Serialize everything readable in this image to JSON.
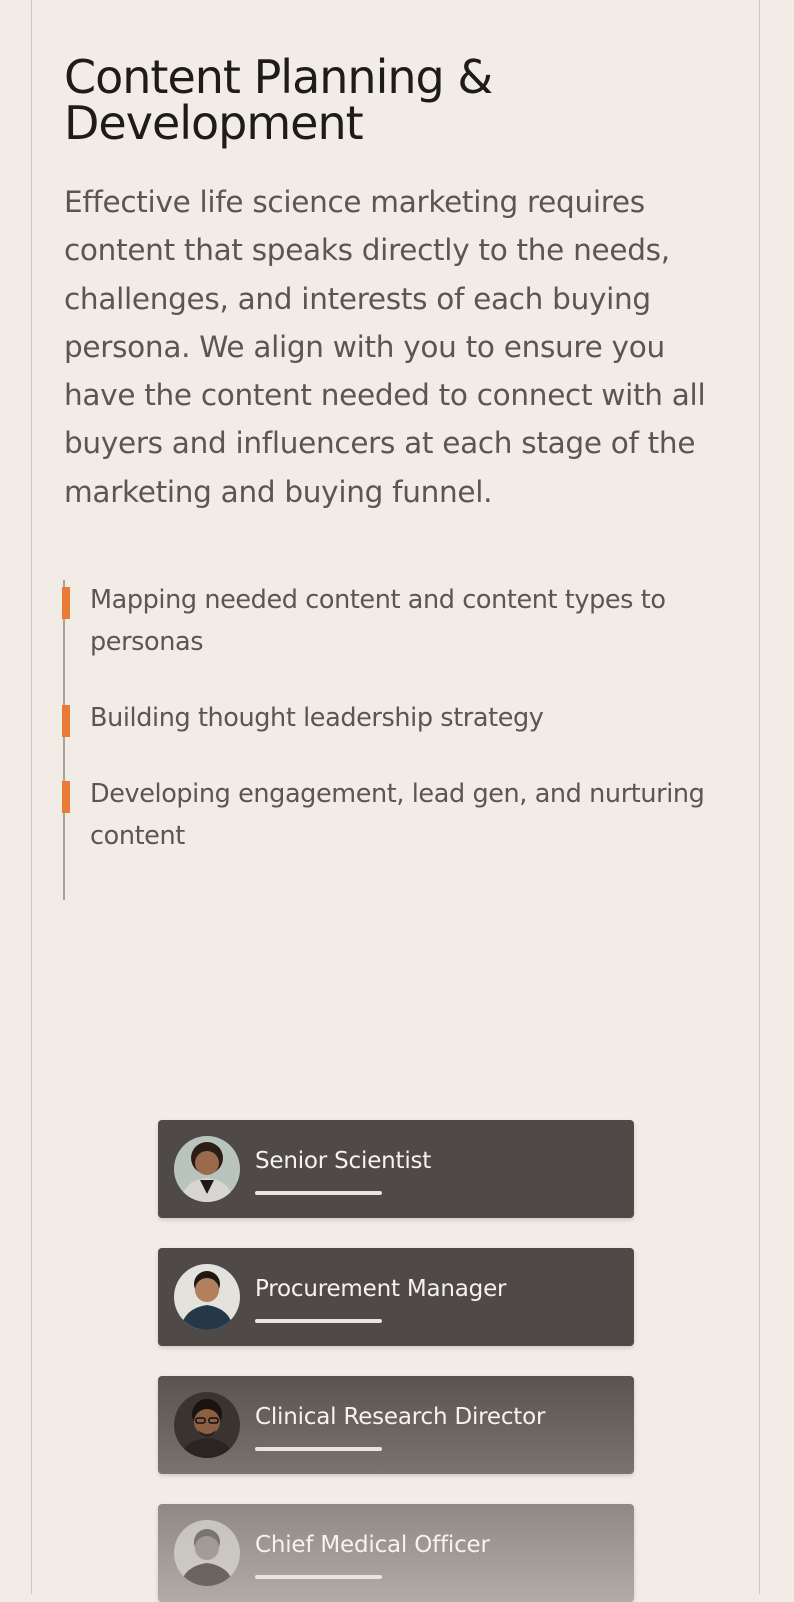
{
  "section": {
    "title": "Content Planning & Development",
    "lead": "Effective life science marketing requires content that speaks directly to the needs, challenges, and interests of each buying persona. We align with you to ensure you have the content needed to connect with all buyers and influencers at each stage of the marketing and buying funnel."
  },
  "checklist": [
    "Mapping needed content and content types to personas",
    "Building thought leadership strategy",
    "Developing engagement, lead gen, and nurturing content"
  ],
  "colors": {
    "accent": "#e87c36",
    "background": "#f1ece6",
    "card": "#4f4a47"
  },
  "personas": [
    {
      "label": "Senior Scientist",
      "avatar": "woman-portrait-icon"
    },
    {
      "label": "Procurement Manager",
      "avatar": "man-portrait-icon"
    },
    {
      "label": "Clinical Research Director",
      "avatar": "man-glasses-portrait-icon"
    },
    {
      "label": "Chief Medical Officer",
      "avatar": "man-portrait-icon"
    }
  ]
}
